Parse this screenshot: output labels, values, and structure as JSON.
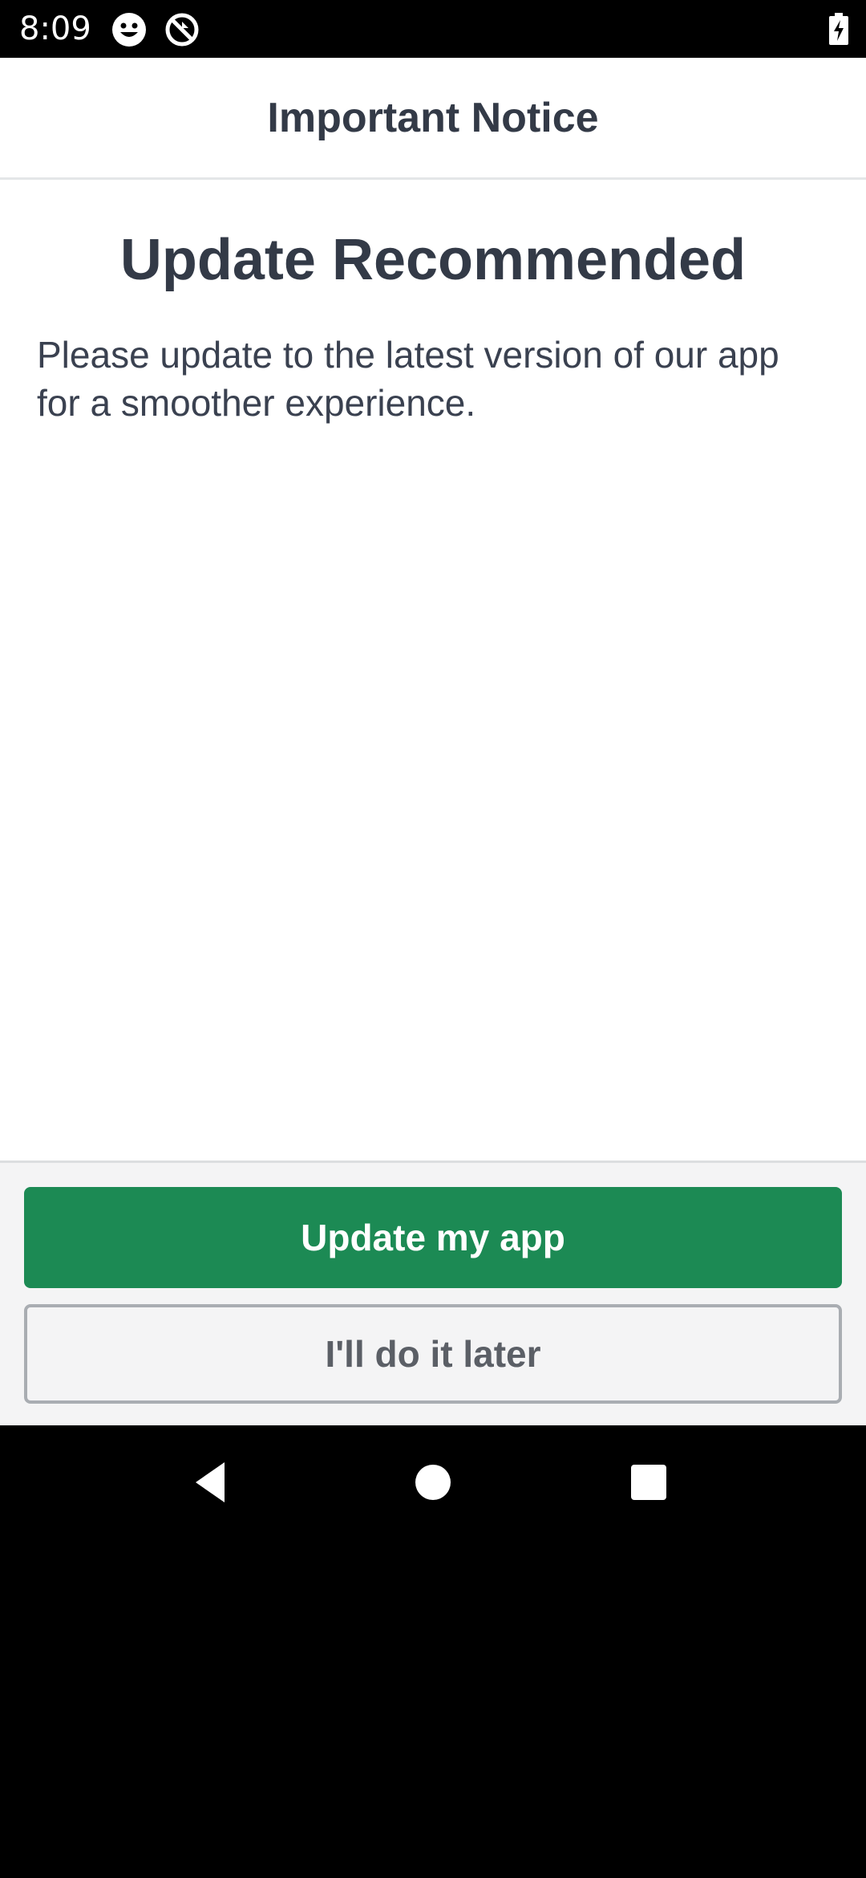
{
  "status_bar": {
    "time": "8:09",
    "icons": [
      "face-icon",
      "sync-disabled-icon",
      "battery-charging-icon"
    ]
  },
  "header": {
    "title": "Important Notice"
  },
  "content": {
    "headline": "Update Recommended",
    "message": "Please update to the latest version of our app for a smoother experience."
  },
  "actions": {
    "primary_label": "Update my app",
    "secondary_label": "I'll do it later"
  },
  "nav_bar": {
    "icons": [
      "back-icon",
      "home-icon",
      "recents-icon"
    ]
  },
  "colors": {
    "primary_button": "#1c8a54",
    "text_dark": "#333a47",
    "footer_bg": "#f4f4f5",
    "secondary_border": "#a9adb2"
  }
}
